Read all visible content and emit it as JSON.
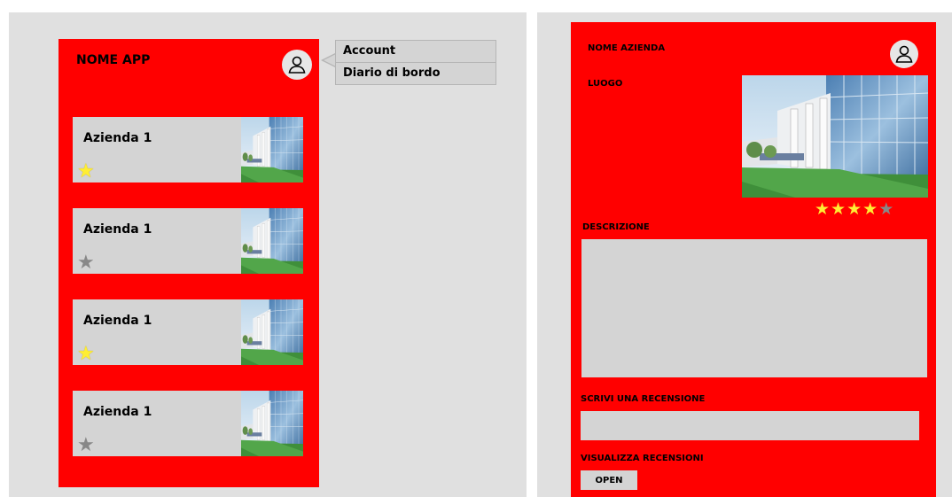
{
  "list_screen": {
    "app_name": "NOME APP",
    "profile_icon": "user-avatar-icon",
    "cards": [
      {
        "name": "Azienda 1",
        "star_color": "#ffee33"
      },
      {
        "name": "Azienda 1",
        "star_color": "#888888"
      },
      {
        "name": "Azienda 1",
        "star_color": "#ffee33"
      },
      {
        "name": "Azienda 1",
        "star_color": "#888888"
      }
    ],
    "menu": {
      "items": [
        "Account",
        "Diario di bordo"
      ]
    }
  },
  "detail_screen": {
    "company_name": "NOME AZIENDA",
    "location": "LUOGO",
    "rating": 4,
    "rating_max": 5,
    "description_label": "DESCRIZIONE",
    "review_label": "SCRIVI UNA RECENSIONE",
    "view_reviews_label": "VISUALIZZA RECENSIONI",
    "open_button": "OPEN"
  },
  "colors": {
    "brand_red": "#ff0000",
    "panel_gray": "#d4d4d4",
    "star_yellow": "#ffee33",
    "star_gray": "#888888"
  }
}
